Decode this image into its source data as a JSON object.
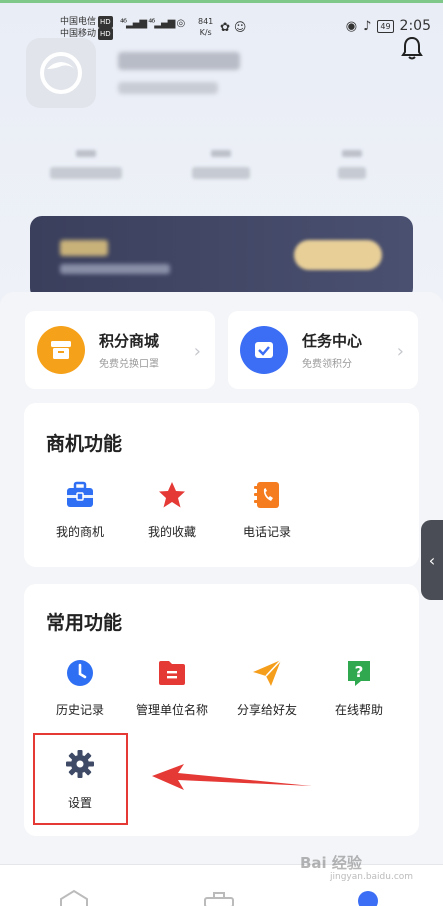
{
  "status_bar": {
    "carrier1": "中国电信",
    "carrier2": "中国移动",
    "hd": "HD",
    "network_speed_value": "841",
    "network_speed_unit": "K/s",
    "battery": "49",
    "time": "2:05"
  },
  "quick_actions": [
    {
      "title": "积分商城",
      "subtitle": "免费兑换口罩",
      "icon": "shop-icon",
      "color": "#f6a11a"
    },
    {
      "title": "任务中心",
      "subtitle": "免费领积分",
      "icon": "task-check-icon",
      "color": "#3b6ef5"
    }
  ],
  "business_section": {
    "title": "商机功能",
    "items": [
      {
        "label": "我的商机",
        "icon": "briefcase-icon",
        "color": "#2f6ff3"
      },
      {
        "label": "我的收藏",
        "icon": "star-icon",
        "color": "#e53935"
      },
      {
        "label": "电话记录",
        "icon": "phone-log-icon",
        "color": "#f57c1f"
      }
    ]
  },
  "common_section": {
    "title": "常用功能",
    "items": [
      {
        "label": "历史记录",
        "icon": "history-clock-icon",
        "color": "#2f6ff3"
      },
      {
        "label": "管理单位名称",
        "icon": "folder-icon",
        "color": "#e53935"
      },
      {
        "label": "分享给好友",
        "icon": "paper-plane-icon",
        "color": "#f59e1b"
      },
      {
        "label": "在线帮助",
        "icon": "help-icon",
        "color": "#2fa84f"
      },
      {
        "label": "设置",
        "icon": "gear-icon",
        "color": "#3f4a66"
      }
    ]
  },
  "annotation": {
    "highlight_color": "#e53935"
  },
  "watermark": {
    "main": "Bai 经验",
    "sub": "jingyan.baidu.com"
  }
}
